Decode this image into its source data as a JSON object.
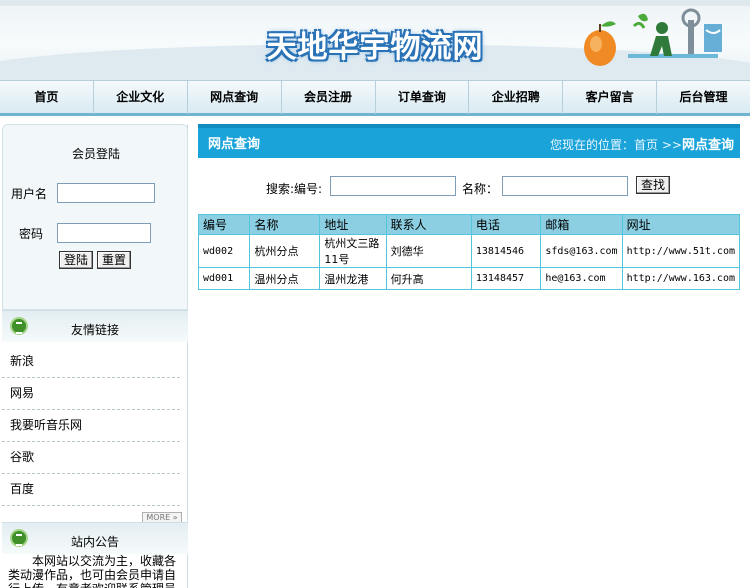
{
  "header": {
    "site_title": "天地华宇物流网"
  },
  "nav": {
    "items": [
      "首页",
      "企业文化",
      "网点查询",
      "会员注册",
      "订单查询",
      "企业招聘",
      "客户留言",
      "后台管理"
    ]
  },
  "login": {
    "title": "会员登陆",
    "username_label": "用户名",
    "password_label": "密码",
    "login_button": "登陆",
    "reset_button": "重置"
  },
  "links": {
    "title": "友情链接",
    "items": [
      "新浪",
      "网易",
      "我要听音乐网",
      "谷歌",
      "百度"
    ],
    "more_label": "MORE »"
  },
  "notice": {
    "title": "站内公告",
    "text": "本网站以交流为主，收藏各类动漫作品，也可由会员申请自行上传，有意者欢迎联系管理员"
  },
  "main": {
    "title": "网点查询",
    "crumb_prefix": "您现在的位置：首页 >>",
    "crumb_current": "网点查询"
  },
  "search": {
    "label_code": "搜索:编号:",
    "label_name": "名称：",
    "button": "查找"
  },
  "table": {
    "headers": [
      "编号",
      "名称",
      "地址",
      "联系人",
      "电话",
      "邮箱",
      "网址"
    ],
    "rows": [
      [
        "wd002",
        "杭州分点",
        "杭州文三路11号",
        "刘德华",
        "13814546",
        "sfds@163.com",
        "http://www.51t.com"
      ],
      [
        "wd001",
        "温州分点",
        "温州龙港",
        "何升高",
        "13148457",
        "he@163.com",
        "http://www.163.com"
      ]
    ]
  },
  "colors": {
    "accent": "#1aa3d9",
    "table_header": "#8ccfe2",
    "table_border": "#52c6dc"
  }
}
